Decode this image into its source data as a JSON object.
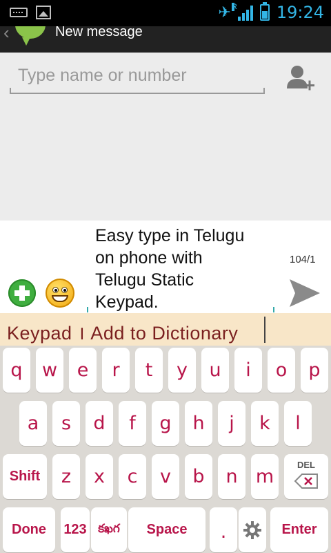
{
  "status_bar": {
    "time": "19:24",
    "signal_label": "R"
  },
  "action_bar": {
    "title": "New message"
  },
  "recipient": {
    "placeholder": "Type name or number"
  },
  "compose": {
    "message_lines": [
      "Easy type in Telugu",
      "on phone with",
      "Telugu Static",
      "Keypad."
    ],
    "char_counter": "104/1"
  },
  "suggestion_bar": {
    "text": "Keypad ।  Add  to  Dictionary"
  },
  "keyboard": {
    "row1": [
      "q",
      "w",
      "e",
      "r",
      "t",
      "y",
      "u",
      "i",
      "o",
      "p"
    ],
    "row2": [
      "a",
      "s",
      "d",
      "f",
      "g",
      "h",
      "j",
      "k",
      "l"
    ],
    "row3_letters": [
      "z",
      "x",
      "c",
      "v",
      "b",
      "n",
      "m"
    ],
    "shift_label": "Shift",
    "del_label": "DEL",
    "done_label": "Done",
    "num_label": "123",
    "lang_label": "కఖగ",
    "space_label": "Space",
    "period_label": ".",
    "enter_label": "Enter"
  },
  "colors": {
    "key_text": "#b8154a",
    "suggest_bg": "#f8e6c8",
    "accent": "#33b5e5"
  }
}
